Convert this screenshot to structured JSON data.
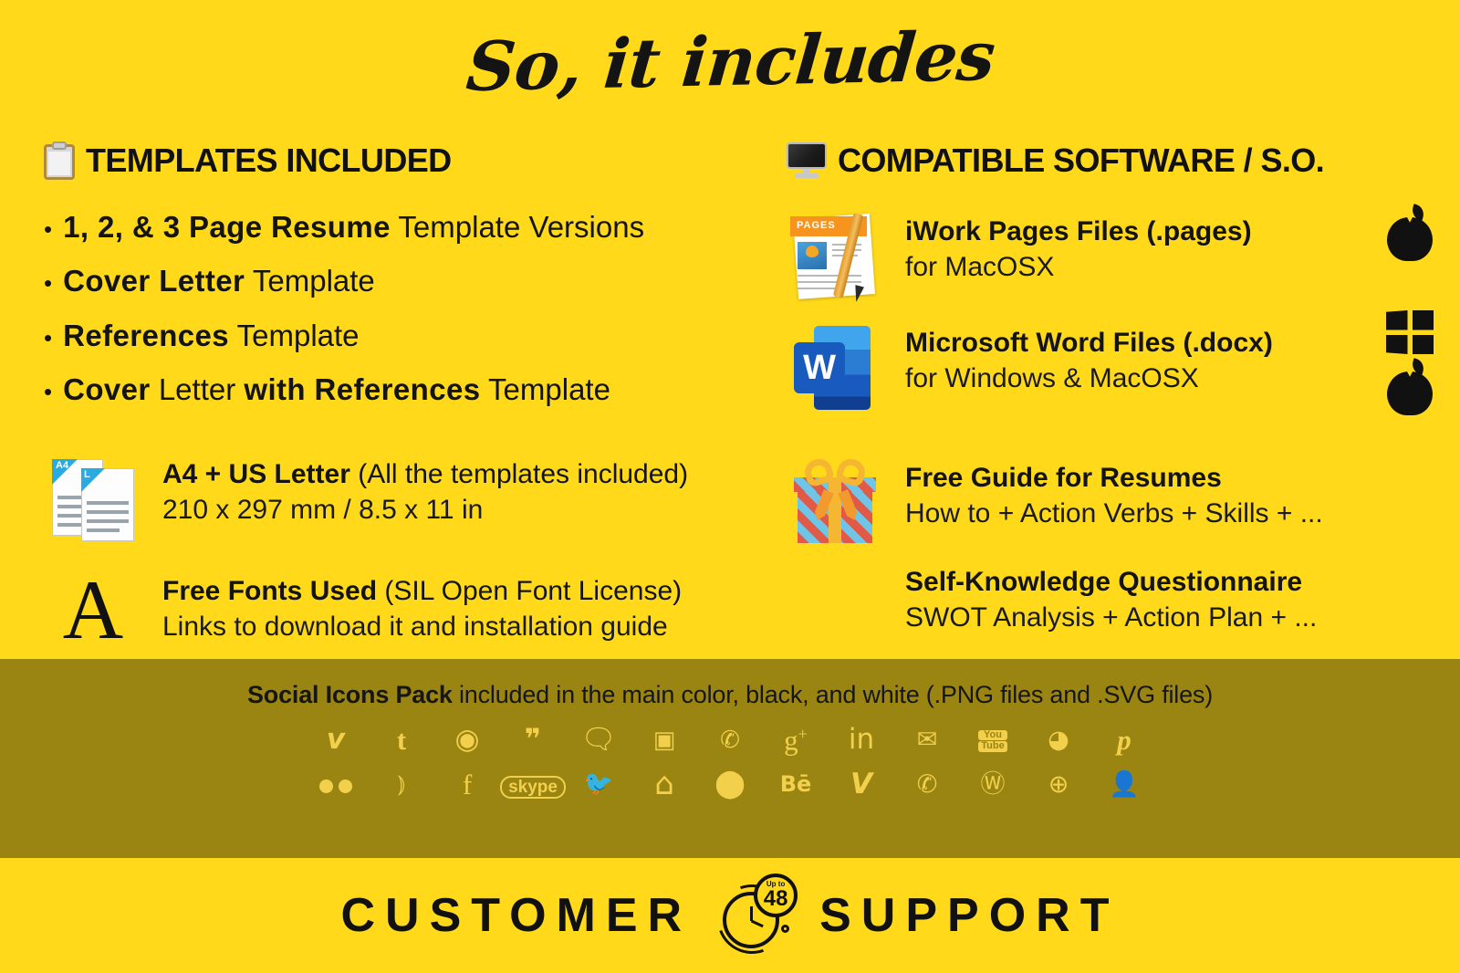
{
  "colors": {
    "background": "#FFD91A",
    "band": "#9A8513",
    "icon_accent": "#F2D04B",
    "text": "#141414"
  },
  "title": "So, it includes",
  "left": {
    "heading": "TEMPLATES INCLUDED",
    "heading_icon": "clipboard-icon",
    "bullets": [
      {
        "bold": "1, 2, & 3 Page Resume",
        "normal": " Template Versions"
      },
      {
        "bold": "Cover Letter",
        "normal": " Template"
      },
      {
        "bold": "References",
        "normal": " Template"
      },
      {
        "bold": "Cover",
        "normal": " Letter ",
        "bold2": "with References",
        "normal2": " Template"
      }
    ],
    "features": [
      {
        "icon": "a4-letter-documents-icon",
        "title": "A4 + US Letter",
        "title_rest": " (All the templates included)",
        "subtitle": "210 x 297 mm / 8.5 x 11 in"
      },
      {
        "icon": "serif-a-glyph-icon",
        "glyph": "A",
        "title": "Free Fonts Used",
        "title_rest": " (SIL Open Font License)",
        "subtitle": "Links to download it and installation guide"
      }
    ]
  },
  "right": {
    "heading": "COMPATIBLE SOFTWARE / S.O.",
    "heading_icon": "monitor-icon",
    "software": [
      {
        "icon": "pages-app-icon",
        "icon_label": "PAGES",
        "title": "iWork Pages Files (.pages)",
        "subtitle": "for MacOSX",
        "os_logos": [
          "apple-logo"
        ]
      },
      {
        "icon": "word-app-icon",
        "icon_letter": "W",
        "title": "Microsoft Word Files (.docx)",
        "subtitle": "for Windows & MacOSX",
        "os_logos": [
          "windows-logo",
          "apple-logo"
        ]
      }
    ],
    "extras": [
      {
        "icon": "gift-box-icon",
        "title": "Free Guide for Resumes",
        "subtitle": "How to + Action Verbs + Skills + ..."
      },
      {
        "icon": null,
        "title": "Self-Knowledge Questionnaire",
        "subtitle": "SWOT Analysis + Action Plan + ..."
      }
    ]
  },
  "band": {
    "title_bold": "Social Icons Pack",
    "title_rest": " included in the main color, black, and white (.PNG files and .SVG files)",
    "row1": [
      {
        "name": "vimeo-icon",
        "glyph": "v"
      },
      {
        "name": "tumblr-icon",
        "glyph": "t"
      },
      {
        "name": "podcast-icon",
        "glyph": "◉"
      },
      {
        "name": "quote-icon",
        "glyph": "❞"
      },
      {
        "name": "chat-bubble-icon",
        "glyph": "💬"
      },
      {
        "name": "instagram-icon",
        "glyph": "📷"
      },
      {
        "name": "phone-call-icon",
        "glyph": "📞"
      },
      {
        "name": "google-plus-icon",
        "glyph": "g+"
      },
      {
        "name": "linkedin-icon",
        "glyph": "in"
      },
      {
        "name": "email-icon",
        "glyph": "✉"
      },
      {
        "name": "youtube-icon",
        "glyph": "You Tube"
      },
      {
        "name": "camera-shutter-icon",
        "glyph": "◕"
      },
      {
        "name": "pinterest-icon",
        "glyph": "p"
      }
    ],
    "row2": [
      {
        "name": "flickr-icon",
        "glyph": "••"
      },
      {
        "name": "rss-icon",
        "glyph": "))"
      },
      {
        "name": "facebook-icon",
        "glyph": "f"
      },
      {
        "name": "skype-icon",
        "glyph": "skype"
      },
      {
        "name": "twitter-icon",
        "glyph": "🐦"
      },
      {
        "name": "home-icon",
        "glyph": "⌂"
      },
      {
        "name": "location-pin-icon",
        "glyph": "📍"
      },
      {
        "name": "behance-icon",
        "glyph": "Bē"
      },
      {
        "name": "vine-icon",
        "glyph": "V"
      },
      {
        "name": "whatsapp-icon",
        "glyph": "✆"
      },
      {
        "name": "wordpress-icon",
        "glyph": "W"
      },
      {
        "name": "globe-www-icon",
        "glyph": "🌐"
      },
      {
        "name": "person-icon",
        "glyph": "👤"
      }
    ]
  },
  "footer": {
    "left_word": "CUSTOMER",
    "right_word": "SUPPORT",
    "badge_caption": "Up to",
    "badge_number": "48",
    "badge_icon": "clock-48h-icon"
  }
}
